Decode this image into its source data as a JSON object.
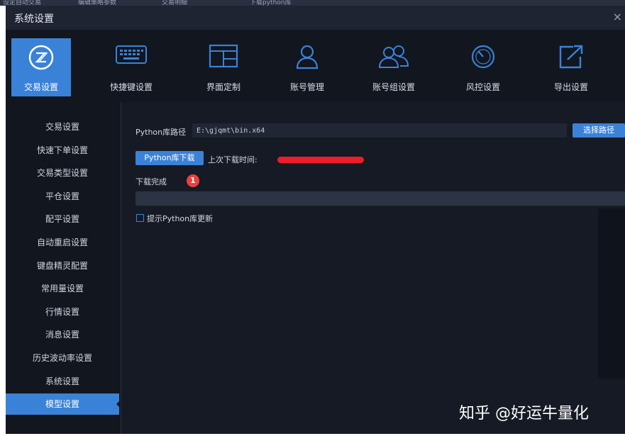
{
  "background_strip": [
    "设定自动交易",
    "编辑策略参数",
    "交易明细",
    "下载python库"
  ],
  "window": {
    "title": "系统设置",
    "close_label": "×"
  },
  "toolbar": {
    "accent_color": "#3a82d8",
    "items": [
      {
        "label": "交易设置",
        "icon": "trade-logo-icon",
        "active": true
      },
      {
        "label": "快捷键设置",
        "icon": "keyboard-icon",
        "active": false
      },
      {
        "label": "界面定制",
        "icon": "layout-icon",
        "active": false
      },
      {
        "label": "账号管理",
        "icon": "user-icon",
        "active": false
      },
      {
        "label": "账号组设置",
        "icon": "users-icon",
        "active": false
      },
      {
        "label": "风控设置",
        "icon": "gauge-icon",
        "active": false
      },
      {
        "label": "导出设置",
        "icon": "export-icon",
        "active": false
      }
    ]
  },
  "sidebar": {
    "items": [
      {
        "label": "交易设置"
      },
      {
        "label": "快速下单设置"
      },
      {
        "label": "交易类型设置"
      },
      {
        "label": "平仓设置"
      },
      {
        "label": "配平设置"
      },
      {
        "label": "自动重启设置"
      },
      {
        "label": "键盘精灵配置"
      },
      {
        "label": "常用量设置"
      },
      {
        "label": "行情设置"
      },
      {
        "label": "消息设置"
      },
      {
        "label": "历史波动率设置"
      },
      {
        "label": "系统设置"
      },
      {
        "label": "模型设置",
        "active": true
      }
    ]
  },
  "main": {
    "python_path_label": "Python库路径",
    "python_path_value": "E:\\gjqmt\\bin.x64",
    "select_path_button": "选择路径",
    "download_button": "Python库下载",
    "last_download_label": "上次下载时间:",
    "status_text": "下载完成",
    "badge_number": "1",
    "progress": 1.0,
    "checkbox_label": "提示Python库更新",
    "checkbox_checked": false
  },
  "watermark": "知乎 @好运牛量化"
}
